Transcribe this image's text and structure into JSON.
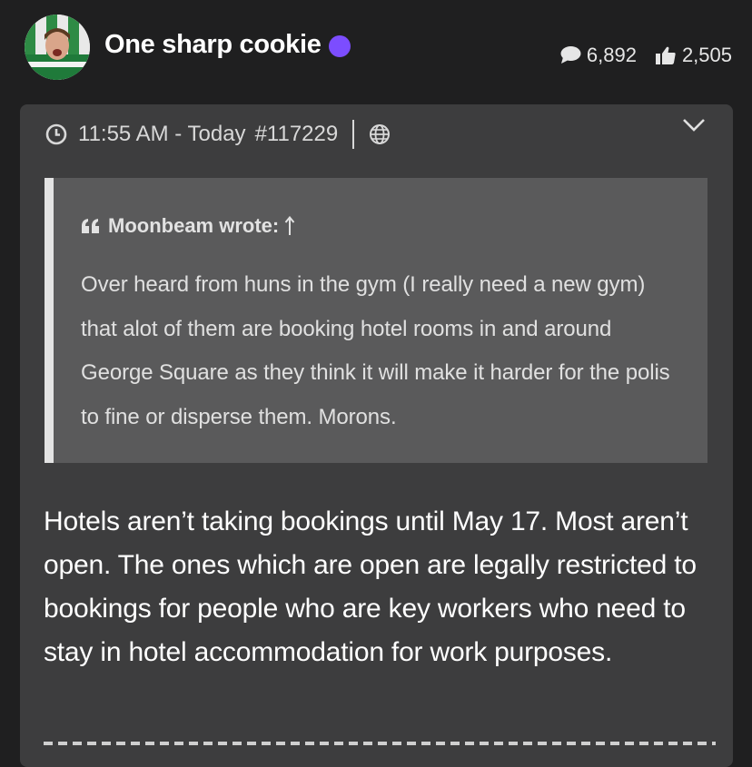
{
  "header": {
    "username": "One sharp cookie",
    "comments_count": "6,892",
    "likes_count": "2,505"
  },
  "post": {
    "time": "11:55 AM - Today",
    "post_number": "#117229",
    "quote": {
      "author": "Moonbeam wrote:",
      "text": "Over heard from huns in the gym (I really need a new gym) that alot of them are booking hotel rooms in and around George Square as they think it will make it harder for the polis to fine or disperse them. Morons."
    },
    "body": "Hotels aren’t taking bookings until May 17. Most aren’t open. The ones which are open are legally restricted to bookings for people who are key workers who need to stay in hotel accommodation for work purposes."
  },
  "icons": {
    "stats_comments": "speech-bubble-icon",
    "stats_likes": "thumbs-up-icon",
    "meta_time": "clock-icon",
    "meta_visibility": "globe-icon",
    "post_menu": "chevron-down-icon",
    "quote_mark": "quote-icon",
    "quote_jump": "up-arrow-icon"
  },
  "colors": {
    "background": "#1f1f20",
    "post_card": "#3d3d3e",
    "quote_block": "#5a5a5b",
    "online_dot": "#7c4dff"
  }
}
